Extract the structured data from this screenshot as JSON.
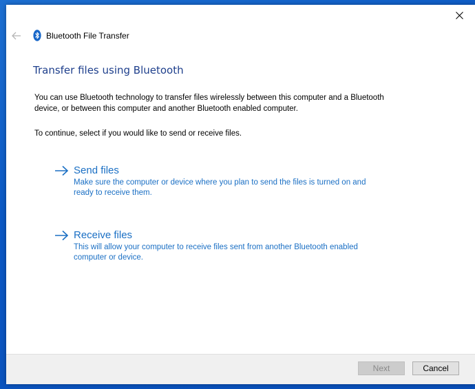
{
  "window": {
    "title": "Bluetooth File Transfer",
    "close_icon": "close-icon",
    "back_icon": "back-arrow-icon",
    "app_icon": "bluetooth-icon"
  },
  "main": {
    "heading": "Transfer files using Bluetooth",
    "intro": "You can use Bluetooth technology to transfer files wirelessly between this computer and a Bluetooth device, or between this computer and another Bluetooth enabled computer.",
    "instruction": "To continue, select if you would like to send or receive files.",
    "options": [
      {
        "title": "Send files",
        "description": "Make sure the computer or device where you plan to send the files is turned on and ready to receive them.",
        "icon": "arrow-right-icon"
      },
      {
        "title": "Receive files",
        "description": "This will allow your computer to receive files sent from another Bluetooth enabled computer or device.",
        "icon": "arrow-right-icon"
      }
    ]
  },
  "footer": {
    "next_label": "Next",
    "cancel_label": "Cancel"
  },
  "colors": {
    "accent": "#1a6fc4",
    "heading": "#1e3f8c",
    "desktop": "#0b58c4"
  }
}
